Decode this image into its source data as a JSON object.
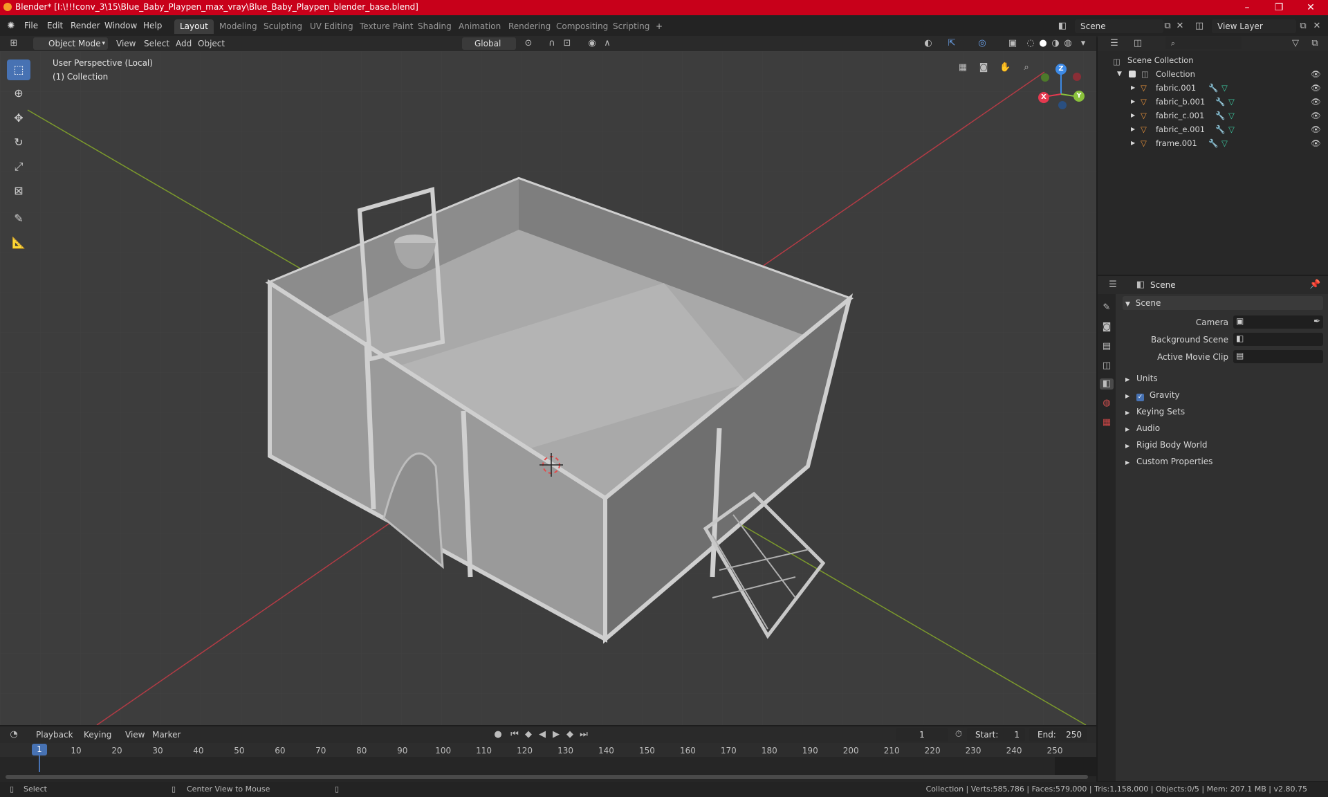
{
  "window": {
    "title": "Blender* [I:\\!!!conv_3\\15\\Blue_Baby_Playpen_max_vray\\Blue_Baby_Playpen_blender_base.blend]",
    "minimize": "–",
    "maximize": "❐",
    "close": "✕"
  },
  "menu": [
    "File",
    "Edit",
    "Render",
    "Window",
    "Help"
  ],
  "workspaces": [
    "Layout",
    "Modeling",
    "Sculpting",
    "UV Editing",
    "Texture Paint",
    "Shading",
    "Animation",
    "Rendering",
    "Compositing",
    "Scripting"
  ],
  "active_workspace": "Layout",
  "scene_field": "Scene",
  "view_layer_field": "View Layer",
  "viewport_header": {
    "mode": "Object Mode",
    "menus": [
      "View",
      "Select",
      "Add",
      "Object"
    ],
    "transform_orientation": "Global"
  },
  "viewport": {
    "perspective_label": "User Perspective (Local)",
    "collection_label": "(1) Collection",
    "gizmo": {
      "x": "X",
      "y": "Y",
      "z": "Z"
    }
  },
  "outliner": {
    "search_placeholder": "",
    "root": "Scene Collection",
    "collection": "Collection",
    "objects": [
      "fabric.001",
      "fabric_b.001",
      "fabric_c.001",
      "fabric_e.001",
      "frame.001"
    ]
  },
  "properties": {
    "context": "Scene",
    "panel_title": "Scene",
    "fields": [
      {
        "label": "Camera",
        "value": ""
      },
      {
        "label": "Background Scene",
        "value": ""
      },
      {
        "label": "Active Movie Clip",
        "value": ""
      }
    ],
    "sections": [
      "Units",
      "Gravity",
      "Keying Sets",
      "Audio",
      "Rigid Body World",
      "Custom Properties"
    ],
    "gravity_checked": true
  },
  "timeline": {
    "menus": [
      "Playback",
      "Keying",
      "View",
      "Marker"
    ],
    "current_frame": "1",
    "start_label": "Start:",
    "start": "1",
    "end_label": "End:",
    "end": "250",
    "ruler": [
      "1",
      "10",
      "20",
      "30",
      "40",
      "50",
      "60",
      "70",
      "80",
      "90",
      "100",
      "110",
      "120",
      "130",
      "140",
      "150",
      "160",
      "170",
      "180",
      "190",
      "200",
      "210",
      "220",
      "230",
      "240",
      "250"
    ]
  },
  "statusbar": {
    "left": "Select",
    "middle": "Center View to Mouse",
    "right": "Collection | Verts:585,786 | Faces:579,000 | Tris:1,158,000 | Objects:0/5 | Mem: 207.1 MB | v2.80.75"
  },
  "colors": {
    "titlebar": "#c8001a",
    "accent": "#4772b3",
    "viewport_bg": "#3d3d3d",
    "axis_x": "#e5394f",
    "axis_y": "#8ac13b",
    "axis_z": "#3d8ae6"
  }
}
